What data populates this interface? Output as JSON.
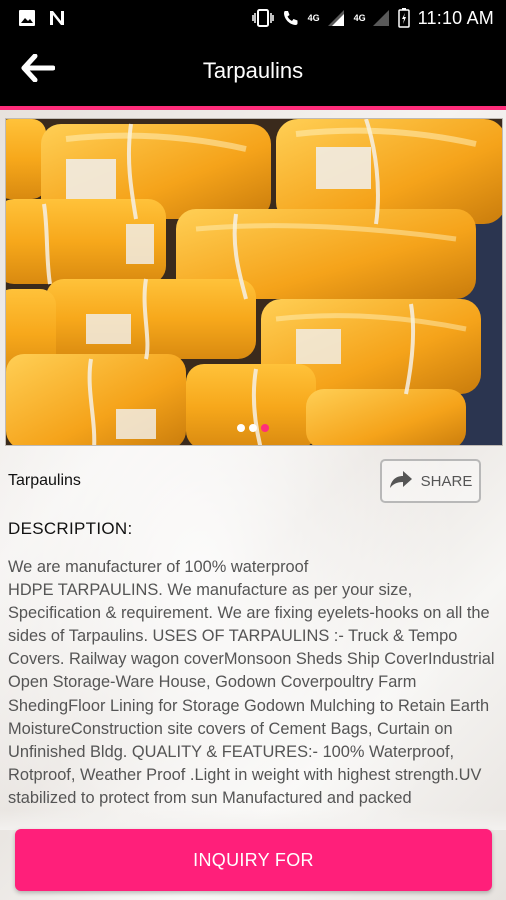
{
  "status_bar": {
    "time": "11:10 AM",
    "net_label_1": "4G",
    "net_label_2": "4G",
    "icons": [
      "image-icon",
      "n-logo-icon",
      "vibrate-icon",
      "wifi-call-icon",
      "signal-icon",
      "battery-icon"
    ]
  },
  "app_bar": {
    "title": "Tarpaulins",
    "back_icon": "arrow-left-icon"
  },
  "carousel": {
    "image_description": "tarpaulin bundles photo",
    "slide_count": 3,
    "active_slide": 3
  },
  "product": {
    "name": "Tarpaulins",
    "share_label": "SHARE"
  },
  "description": {
    "heading": "DESCRIPTION:",
    "text": "We are manufacturer of 100% waterproof\nHDPE TARPAULINS. We manufacture as per your size, Specification & requirement. We are fixing eyelets-hooks on all the sides of Tarpaulins. USES OF TARPAULINS :- Truck & Tempo Covers.  Railway wagon coverMonsoon Sheds    Ship CoverIndustrial Open Storage-Ware House, Godown Coverpoultry Farm ShedingFloor Lining for Storage Godown Mulching to Retain Earth MoistureConstruction site covers of Cement Bags, Curtain on Unfinished Bldg. QUALITY & FEATURES:-     100% Waterproof, Rotproof, Weather Proof .Light in weight with highest strength.UV stabilized to protect from sun Manufactured and packed"
  },
  "footer": {
    "inquiry_label": "INQUIRY FOR"
  },
  "colors": {
    "accent": "#ff1f7a",
    "app_bar": "#000000",
    "tarp": "#f7a81b"
  }
}
